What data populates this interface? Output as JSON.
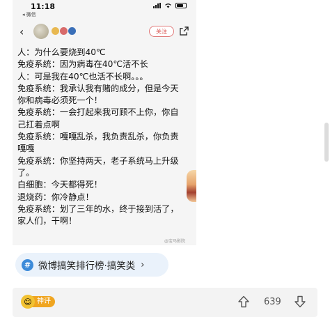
{
  "status_bar": {
    "time": "11:18",
    "back_app": "◂ 微信"
  },
  "post_header": {
    "follow_label": "关注",
    "badge_colors": [
      "#e8b850",
      "#d86a6a",
      "#3a6fb8"
    ]
  },
  "post_text_lines": [
    "人：为什么要烧到40℃",
    "免疫系统：因为病毒在40℃活不长",
    "人：可是我在40℃也活不长啊。。。",
    "免疫系统：我承认我有赌的成分，但是今天",
    "你和病毒必须死一个！",
    "免疫系统：一会打起来我可顾不上你，你自",
    "己扛着点啊",
    "免疫系统：嘎嘎乱杀，我负责乱杀，你负责",
    "嘎嘎",
    "免疫系统：你坚持两天，老子系统马上升级",
    "了。",
    "白细胞：今天都得死！",
    "退烧药：你冷静点！",
    "免疫系统：划了三年的水，终于接到活了，",
    "家人们，干啊！"
  ],
  "watermark": "@宝马影院",
  "topic": {
    "hash_glyph": "#",
    "label": "微博搞笑排行榜·搞笑类",
    "chevron": "›"
  },
  "bottom_bar": {
    "badge_label": "神评",
    "badge_face": "☺",
    "like_count": "639"
  },
  "colors": {
    "accent_blue": "#3d8bd9",
    "follow_red": "#d9534f",
    "badge_orange": "#f0a520"
  }
}
